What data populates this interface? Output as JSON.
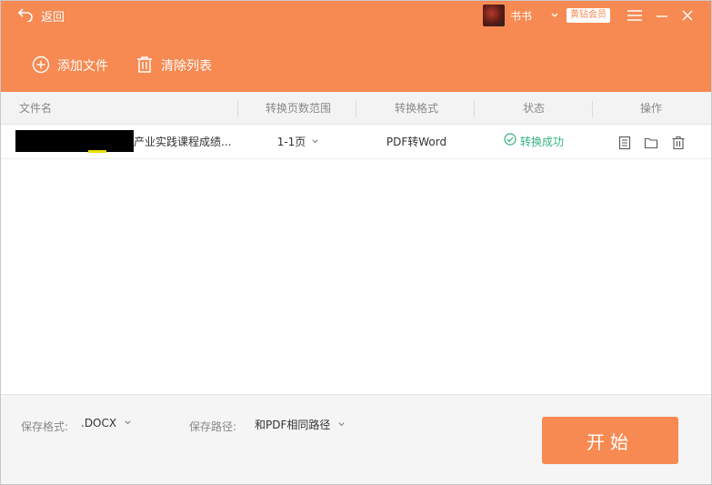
{
  "header": {
    "back_label": "返回",
    "username": "书书",
    "vip_badge": "黄钻会员",
    "add_file_label": "添加文件",
    "clear_list_label": "清除列表",
    "accent_color": "#f68a52"
  },
  "table": {
    "columns": [
      "文件名",
      "转换页数范围",
      "转换格式",
      "状态",
      "操作"
    ],
    "rows": [
      {
        "file_name_visible": "产业实践课程成绩...",
        "page_range": "1-1页",
        "format": "PDF转Word",
        "status": "转换成功",
        "actions": [
          "file-icon",
          "folder-icon",
          "trash-icon"
        ]
      }
    ]
  },
  "footer": {
    "save_format_label": "保存格式:",
    "save_format_value": ".DOCX",
    "save_path_label": "保存路径:",
    "save_path_value": "和PDF相同路径",
    "start_label": "开始"
  }
}
